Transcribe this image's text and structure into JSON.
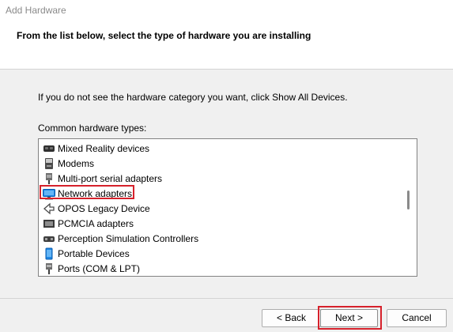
{
  "window": {
    "title": "Add Hardware"
  },
  "header": {
    "heading": "From the list below, select the type of hardware you are installing"
  },
  "main": {
    "instruction": "If you do not see the hardware category you want, click Show All Devices.",
    "list_label": "Common hardware types:"
  },
  "hardware_list": {
    "items": [
      {
        "label": "Mixed Reality devices",
        "icon": "mixed-reality-headset-icon"
      },
      {
        "label": "Modems",
        "icon": "modem-icon"
      },
      {
        "label": "Multi-port serial adapters",
        "icon": "serial-adapter-icon"
      },
      {
        "label": "Network adapters",
        "icon": "network-adapter-icon",
        "highlighted": true
      },
      {
        "label": "OPOS Legacy Device",
        "icon": "opos-device-icon"
      },
      {
        "label": "PCMCIA adapters",
        "icon": "pcmcia-adapter-icon"
      },
      {
        "label": "Perception Simulation Controllers",
        "icon": "perception-controller-icon"
      },
      {
        "label": "Portable Devices",
        "icon": "portable-device-icon"
      },
      {
        "label": "Ports (COM & LPT)",
        "icon": "ports-icon"
      }
    ]
  },
  "footer": {
    "back_label": "< Back",
    "next_label": "Next >",
    "cancel_label": "Cancel"
  },
  "colors": {
    "highlight": "#d6212b",
    "background": "#f0f0f0",
    "header_background": "#ffffff",
    "network_adapter_blue": "#1e88e5"
  }
}
